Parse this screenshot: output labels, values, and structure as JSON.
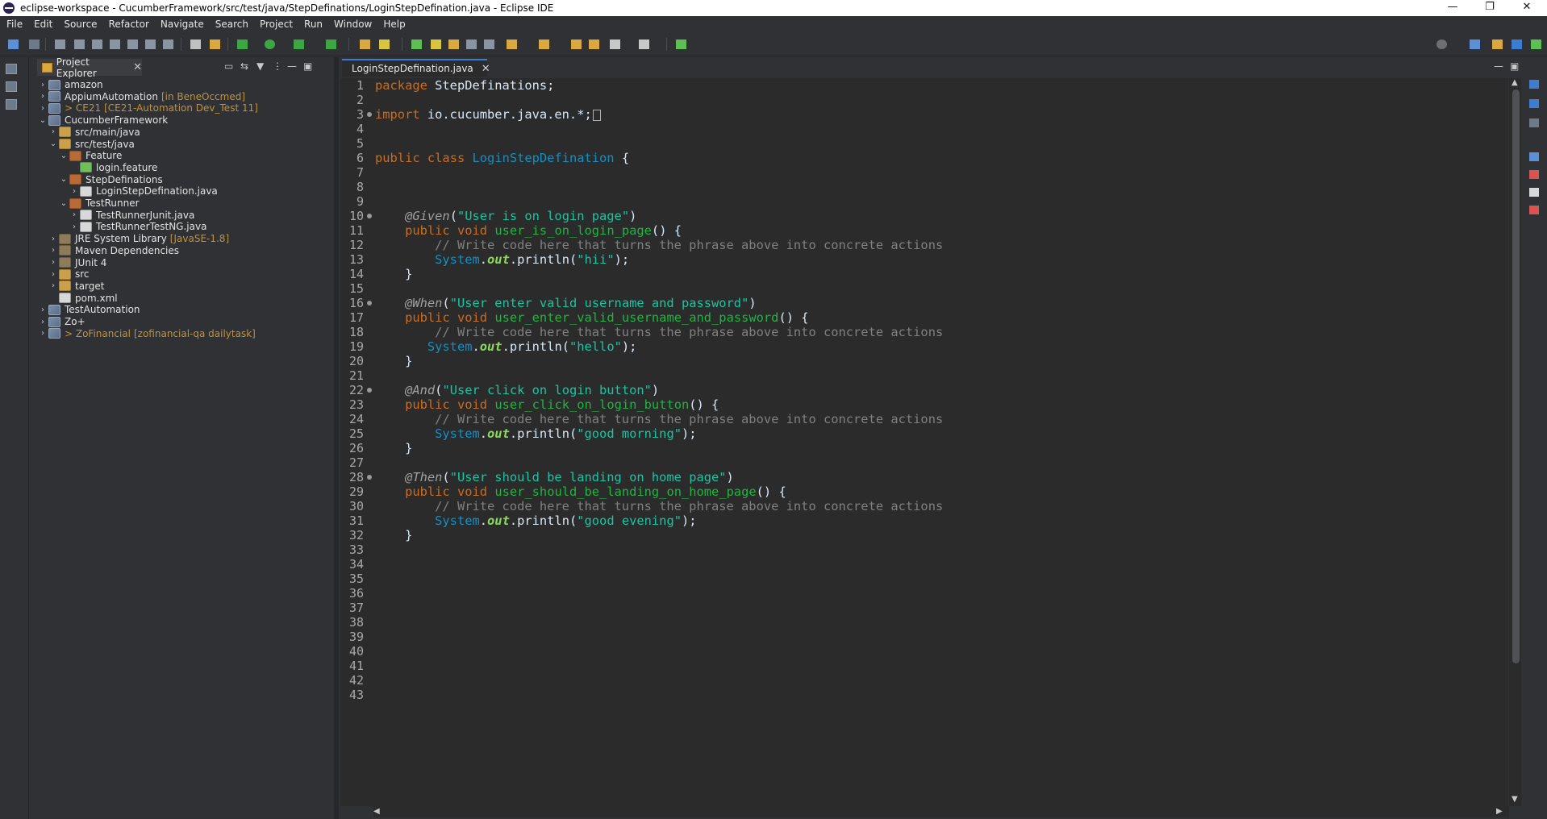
{
  "window": {
    "title": "eclipse-workspace - CucumberFramework/src/test/java/StepDefinations/LoginStepDefination.java - Eclipse IDE",
    "minimize": "—",
    "maximize": "❐",
    "close": "✕"
  },
  "menu": [
    "File",
    "Edit",
    "Source",
    "Refactor",
    "Navigate",
    "Search",
    "Project",
    "Run",
    "Window",
    "Help"
  ],
  "explorer": {
    "title": "Project Explorer",
    "close": "✕",
    "tools": [
      "▭",
      "⇆",
      "▼",
      "⋮",
      "—",
      "▣"
    ],
    "tree": [
      {
        "label": "amazon",
        "decor": "",
        "twisty": "›",
        "icon": "project",
        "indent": 0
      },
      {
        "label": "AppiumAutomation",
        "decor": "[in BeneOccmed]",
        "twisty": "›",
        "icon": "project",
        "indent": 0
      },
      {
        "label": "> CE21",
        "decor": "[CE21-Automation Dev_Test 11]",
        "twisty": "›",
        "icon": "project",
        "indent": 0,
        "git": true
      },
      {
        "label": "CucumberFramework",
        "decor": "",
        "twisty": "⌄",
        "icon": "project",
        "indent": 0
      },
      {
        "label": "src/main/java",
        "decor": "",
        "twisty": "›",
        "icon": "folder",
        "indent": 1
      },
      {
        "label": "src/test/java",
        "decor": "",
        "twisty": "⌄",
        "icon": "folder",
        "indent": 1
      },
      {
        "label": "Feature",
        "decor": "",
        "twisty": "⌄",
        "icon": "package",
        "indent": 2
      },
      {
        "label": "login.feature",
        "decor": "",
        "twisty": "",
        "icon": "feature",
        "indent": 3
      },
      {
        "label": "StepDefinations",
        "decor": "",
        "twisty": "⌄",
        "icon": "package",
        "indent": 2
      },
      {
        "label": "LoginStepDefination.java",
        "decor": "",
        "twisty": "›",
        "icon": "java",
        "indent": 3
      },
      {
        "label": "TestRunner",
        "decor": "",
        "twisty": "⌄",
        "icon": "package",
        "indent": 2
      },
      {
        "label": "TestRunnerJunit.java",
        "decor": "",
        "twisty": "›",
        "icon": "java",
        "indent": 3
      },
      {
        "label": "TestRunnerTestNG.java",
        "decor": "",
        "twisty": "›",
        "icon": "java",
        "indent": 3
      },
      {
        "label": "JRE System Library",
        "decor": "[JavaSE-1.8]",
        "twisty": "›",
        "icon": "lib",
        "indent": 1
      },
      {
        "label": "Maven Dependencies",
        "decor": "",
        "twisty": "›",
        "icon": "lib",
        "indent": 1
      },
      {
        "label": "JUnit 4",
        "decor": "",
        "twisty": "›",
        "icon": "lib",
        "indent": 1
      },
      {
        "label": "src",
        "decor": "",
        "twisty": "›",
        "icon": "folder",
        "indent": 1
      },
      {
        "label": "target",
        "decor": "",
        "twisty": "›",
        "icon": "folder",
        "indent": 1
      },
      {
        "label": "pom.xml",
        "decor": "",
        "twisty": "",
        "icon": "xml",
        "indent": 1
      },
      {
        "label": "TestAutomation",
        "decor": "",
        "twisty": "›",
        "icon": "project",
        "indent": 0
      },
      {
        "label": "Zo+",
        "decor": "",
        "twisty": "›",
        "icon": "project",
        "indent": 0
      },
      {
        "label": "> ZoFinancial",
        "decor": "[zofinancial-qa dailytask]",
        "twisty": "›",
        "icon": "project",
        "indent": 0,
        "git": true
      }
    ]
  },
  "editor": {
    "tab_label": "LoginStepDefination.java",
    "tab_close": "✕",
    "minimize": "—",
    "maximize": "▣",
    "fold_lines": [
      3,
      10,
      16,
      22,
      28
    ],
    "line_count": 43,
    "lines": [
      [
        [
          "kw",
          "package"
        ],
        [
          "txt",
          " StepDefinations;"
        ]
      ],
      [],
      [
        [
          "kw",
          "import"
        ],
        [
          "txt",
          " io.cucumber.java.en.*;"
        ],
        [
          "box",
          ""
        ]
      ],
      [],
      [],
      [
        [
          "kw",
          "public"
        ],
        [
          "txt",
          " "
        ],
        [
          "kw",
          "class"
        ],
        [
          "txt",
          " "
        ],
        [
          "cls",
          "LoginStepDefination"
        ],
        [
          "txt",
          " {"
        ]
      ],
      [],
      [],
      [],
      [
        [
          "txt",
          "    "
        ],
        [
          "ann",
          "@Given"
        ],
        [
          "txt",
          "("
        ],
        [
          "str",
          "\"User is on login page\""
        ],
        [
          "txt",
          ")"
        ]
      ],
      [
        [
          "txt",
          "    "
        ],
        [
          "kw",
          "public"
        ],
        [
          "txt",
          " "
        ],
        [
          "kw",
          "void"
        ],
        [
          "txt",
          " "
        ],
        [
          "mth",
          "user_is_on_login_page"
        ],
        [
          "txt",
          "() {"
        ]
      ],
      [
        [
          "txt",
          "        "
        ],
        [
          "cmt",
          "// Write code here that turns the phrase above into concrete actions"
        ]
      ],
      [
        [
          "txt",
          "        "
        ],
        [
          "cls",
          "System"
        ],
        [
          "txt",
          "."
        ],
        [
          "fld",
          "out"
        ],
        [
          "txt",
          ".println("
        ],
        [
          "str",
          "\"hii\""
        ],
        [
          "txt",
          ");"
        ]
      ],
      [
        [
          "txt",
          "    }"
        ]
      ],
      [],
      [
        [
          "txt",
          "    "
        ],
        [
          "ann",
          "@When"
        ],
        [
          "txt",
          "("
        ],
        [
          "str",
          "\"User enter valid username and password\""
        ],
        [
          "txt",
          ")"
        ]
      ],
      [
        [
          "txt",
          "    "
        ],
        [
          "kw",
          "public"
        ],
        [
          "txt",
          " "
        ],
        [
          "kw",
          "void"
        ],
        [
          "txt",
          " "
        ],
        [
          "mth",
          "user_enter_valid_username_and_password"
        ],
        [
          "txt",
          "() {"
        ]
      ],
      [
        [
          "txt",
          "        "
        ],
        [
          "cmt",
          "// Write code here that turns the phrase above into concrete actions"
        ]
      ],
      [
        [
          "txt",
          "       "
        ],
        [
          "cls",
          "System"
        ],
        [
          "txt",
          "."
        ],
        [
          "fld",
          "out"
        ],
        [
          "txt",
          ".println("
        ],
        [
          "str",
          "\"hello\""
        ],
        [
          "txt",
          ");"
        ]
      ],
      [
        [
          "txt",
          "    }"
        ]
      ],
      [],
      [
        [
          "txt",
          "    "
        ],
        [
          "ann",
          "@And"
        ],
        [
          "txt",
          "("
        ],
        [
          "str",
          "\"User click on login button\""
        ],
        [
          "txt",
          ")"
        ]
      ],
      [
        [
          "txt",
          "    "
        ],
        [
          "kw",
          "public"
        ],
        [
          "txt",
          " "
        ],
        [
          "kw",
          "void"
        ],
        [
          "txt",
          " "
        ],
        [
          "mth",
          "user_click_on_login_button"
        ],
        [
          "txt",
          "() {"
        ]
      ],
      [
        [
          "txt",
          "        "
        ],
        [
          "cmt",
          "// Write code here that turns the phrase above into concrete actions"
        ]
      ],
      [
        [
          "txt",
          "        "
        ],
        [
          "cls",
          "System"
        ],
        [
          "txt",
          "."
        ],
        [
          "fld",
          "out"
        ],
        [
          "txt",
          ".println("
        ],
        [
          "str",
          "\"good morning\""
        ],
        [
          "txt",
          ");"
        ]
      ],
      [
        [
          "txt",
          "    }"
        ]
      ],
      [],
      [
        [
          "txt",
          "    "
        ],
        [
          "ann",
          "@Then"
        ],
        [
          "txt",
          "("
        ],
        [
          "str",
          "\"User should be landing on home page\""
        ],
        [
          "txt",
          ")"
        ]
      ],
      [
        [
          "txt",
          "    "
        ],
        [
          "kw",
          "public"
        ],
        [
          "txt",
          " "
        ],
        [
          "kw",
          "void"
        ],
        [
          "txt",
          " "
        ],
        [
          "mth",
          "user_should_be_landing_on_home_page"
        ],
        [
          "txt",
          "() {"
        ]
      ],
      [
        [
          "txt",
          "        "
        ],
        [
          "cmt",
          "// Write code here that turns the phrase above into concrete actions"
        ]
      ],
      [
        [
          "txt",
          "        "
        ],
        [
          "cls",
          "System"
        ],
        [
          "txt",
          "."
        ],
        [
          "fld",
          "out"
        ],
        [
          "txt",
          ".println("
        ],
        [
          "str",
          "\"good evening\""
        ],
        [
          "txt",
          ");"
        ]
      ],
      [
        [
          "txt",
          "    }"
        ]
      ]
    ]
  },
  "colors": {
    "keyword": "#cc6c1d",
    "class": "#1290c3",
    "string": "#17c6a3",
    "comment": "#808080",
    "method": "#1eb540",
    "field": "#8dda5b",
    "background": "#2b2b2b"
  }
}
